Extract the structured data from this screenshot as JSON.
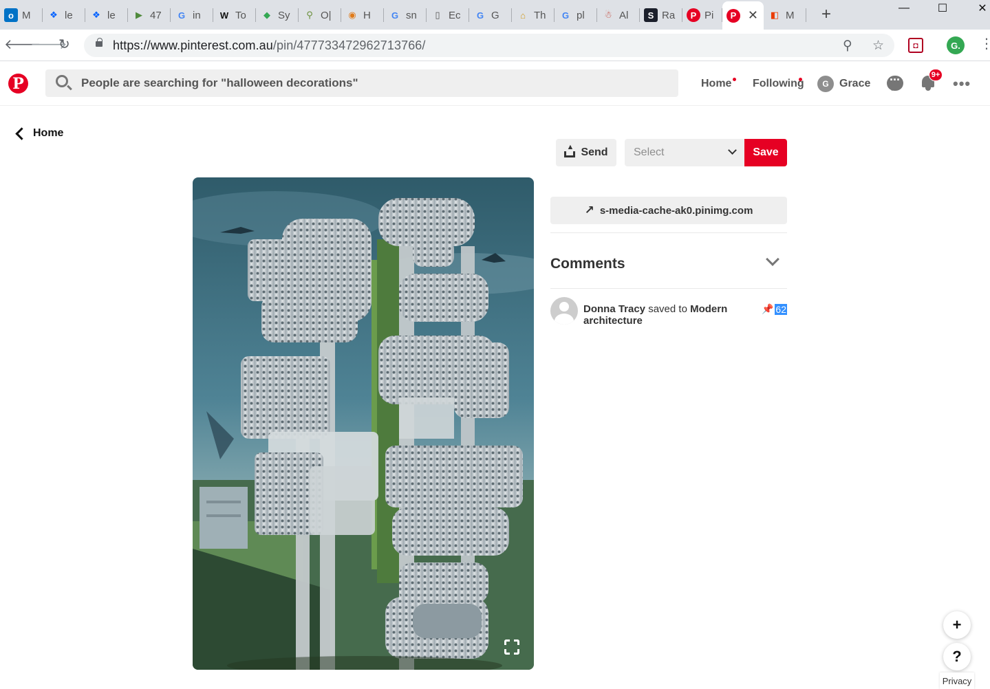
{
  "browser": {
    "tabs": [
      {
        "icon": "outlook-icon",
        "label": "M",
        "fav_text": "o",
        "fav_bg": "#0072c6",
        "fav_fg": "#fff"
      },
      {
        "icon": "dropbox-icon",
        "label": "le",
        "fav_text": "❖",
        "fav_bg": "transparent",
        "fav_fg": "#0061ff"
      },
      {
        "icon": "dropbox-icon",
        "label": "le",
        "fav_text": "❖",
        "fav_bg": "transparent",
        "fav_fg": "#0061ff"
      },
      {
        "icon": "arrow-flag-icon",
        "label": "47",
        "fav_text": "▶",
        "fav_bg": "transparent",
        "fav_fg": "#4f8a3c"
      },
      {
        "icon": "google-icon",
        "label": "in",
        "fav_text": "G",
        "fav_bg": "transparent",
        "fav_fg": "#4285f4"
      },
      {
        "icon": "wikipedia-icon",
        "label": "To",
        "fav_text": "W",
        "fav_bg": "transparent",
        "fav_fg": "#111"
      },
      {
        "icon": "google-maps-icon",
        "label": "Sy",
        "fav_text": "◆",
        "fav_bg": "transparent",
        "fav_fg": "#34a853"
      },
      {
        "icon": "magnifier-icon",
        "label": "O|",
        "fav_text": "⚲",
        "fav_bg": "transparent",
        "fav_fg": "#6a8f3b"
      },
      {
        "icon": "colorful-circle-icon",
        "label": "H",
        "fav_text": "◉",
        "fav_bg": "transparent",
        "fav_fg": "#e07b1a"
      },
      {
        "icon": "google-icon",
        "label": "sn",
        "fav_text": "G",
        "fav_bg": "transparent",
        "fav_fg": "#4285f4"
      },
      {
        "icon": "document-icon",
        "label": "Ec",
        "fav_text": "▯",
        "fav_bg": "transparent",
        "fav_fg": "#555"
      },
      {
        "icon": "google-icon",
        "label": "G",
        "fav_text": "G",
        "fav_bg": "transparent",
        "fav_fg": "#4285f4"
      },
      {
        "icon": "hut-icon",
        "label": "Th",
        "fav_text": "⌂",
        "fav_bg": "transparent",
        "fav_fg": "#d09b1f"
      },
      {
        "icon": "google-icon",
        "label": "pl",
        "fav_text": "G",
        "fav_bg": "transparent",
        "fav_fg": "#4285f4"
      },
      {
        "icon": "doll-icon",
        "label": "Al",
        "fav_text": "☃",
        "fav_bg": "transparent",
        "fav_fg": "#c0392b"
      },
      {
        "icon": "s-icon",
        "label": "Ra",
        "fav_text": "S",
        "fav_bg": "#1b1f2b",
        "fav_fg": "#fff"
      },
      {
        "icon": "pinterest-icon",
        "label": "Pi",
        "fav_text": "P",
        "fav_bg": "#e60023",
        "fav_fg": "#fff"
      },
      {
        "icon": "pinterest-icon",
        "label": "",
        "fav_text": "P",
        "fav_bg": "#e60023",
        "fav_fg": "#fff",
        "active": true
      },
      {
        "icon": "office-icon",
        "label": "M",
        "fav_text": "◧",
        "fav_bg": "transparent",
        "fav_fg": "#eb3c00"
      }
    ],
    "new_tab": "+",
    "window_controls": {
      "minimize": "—",
      "maximize": "☐",
      "close": "✕"
    },
    "url_host": "https://www.pinterest.com.au",
    "url_path": "/pin/477733472962713766/",
    "profile_initial": "G."
  },
  "header": {
    "search_placeholder": "People are searching for \"halloween decorations\"",
    "nav_home": "Home",
    "nav_following": "Following",
    "user_initial": "G",
    "user_name": "Grace",
    "notification_badge": "9+",
    "more": "•••"
  },
  "pin": {
    "back_label": "Home",
    "send_label": "Send",
    "board_select": "Select",
    "save_label": "Save",
    "source_domain": "s-media-cache-ak0.pinimg.com",
    "comments_heading": "Comments",
    "activity": {
      "user": "Donna Tracy",
      "action": "saved to",
      "board": "Modern architecture",
      "repin_count": "62"
    }
  },
  "floating": {
    "add": "+",
    "help": "?",
    "privacy": "Privacy"
  },
  "colors": {
    "pinterest_red": "#e60023",
    "chrome_frame": "#dee1e6"
  }
}
